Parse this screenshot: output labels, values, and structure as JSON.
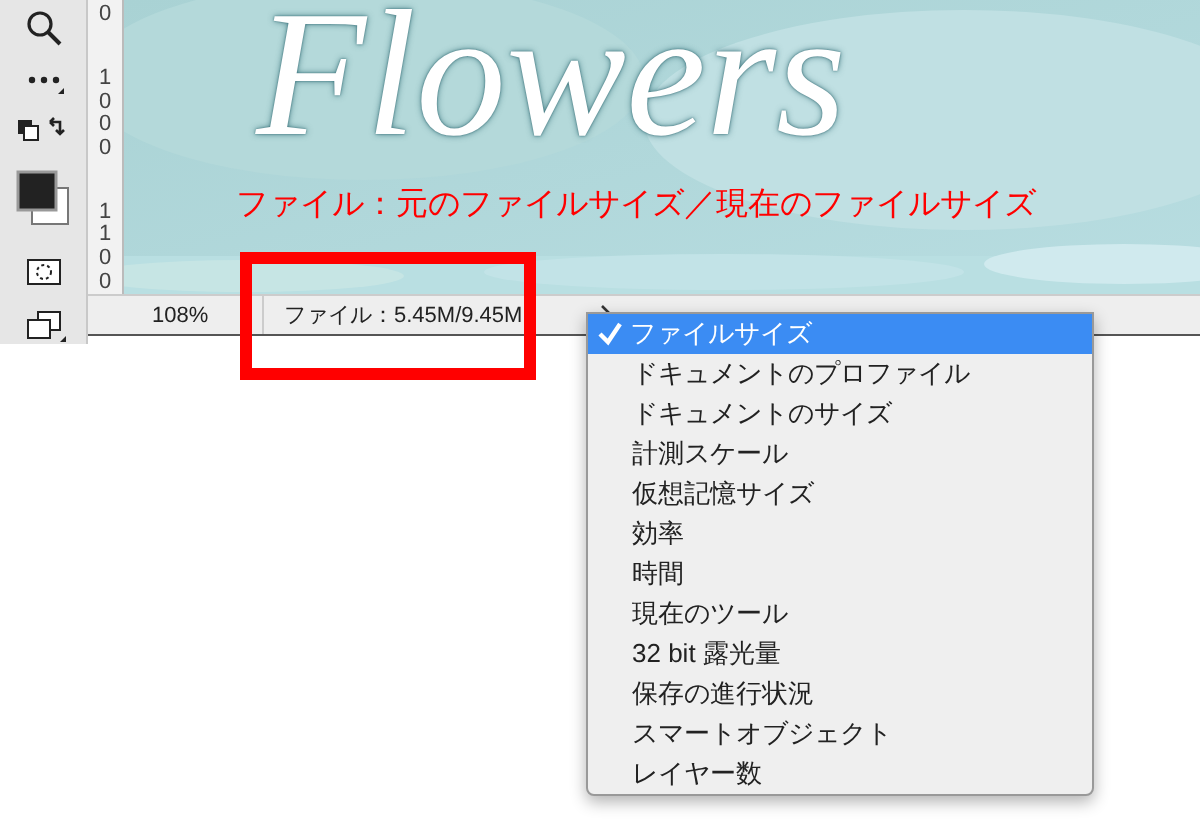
{
  "ruler": {
    "labels": [
      "0",
      "1000",
      "1100"
    ]
  },
  "canvas": {
    "title": "Flowers"
  },
  "annotation": {
    "text": "ファイル：元のファイルサイズ／現在のファイルサイズ"
  },
  "status_bar": {
    "zoom": "108%",
    "info": "ファイル：5.45M/9.45M"
  },
  "menu": {
    "items": [
      {
        "label": "ファイルサイズ",
        "selected": true
      },
      {
        "label": "ドキュメントのプロファイル",
        "selected": false
      },
      {
        "label": "ドキュメントのサイズ",
        "selected": false
      },
      {
        "label": "計測スケール",
        "selected": false
      },
      {
        "label": "仮想記憶サイズ",
        "selected": false
      },
      {
        "label": "効率",
        "selected": false
      },
      {
        "label": "時間",
        "selected": false
      },
      {
        "label": "現在のツール",
        "selected": false
      },
      {
        "label": "32 bit 露光量",
        "selected": false
      },
      {
        "label": "保存の進行状況",
        "selected": false
      },
      {
        "label": "スマートオブジェクト",
        "selected": false
      },
      {
        "label": "レイヤー数",
        "selected": false
      }
    ]
  }
}
